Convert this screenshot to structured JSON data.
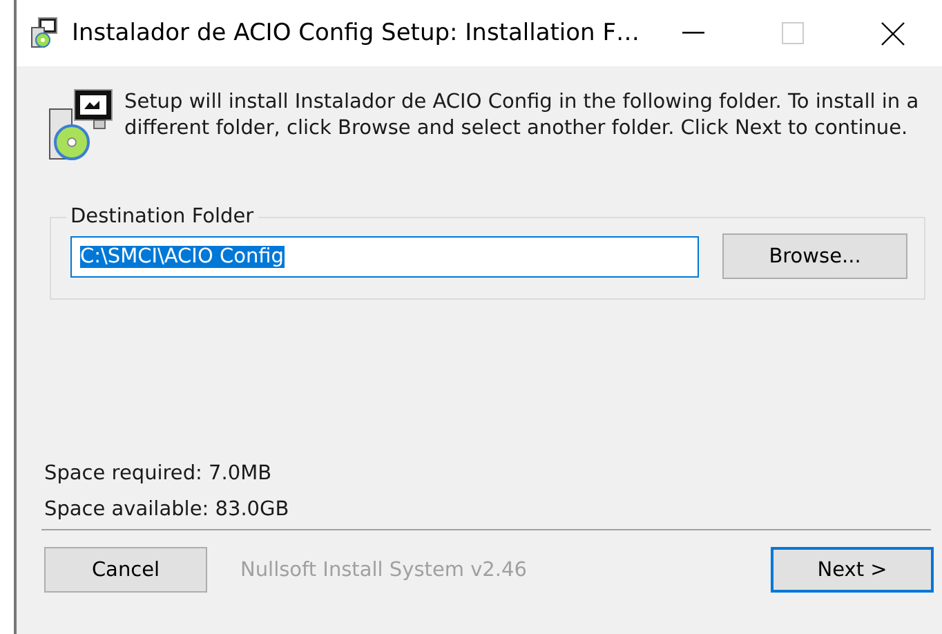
{
  "window": {
    "title": "Instalador de ACIO Config Setup: Installation F…",
    "maximize_disabled": true
  },
  "intro": "Setup will install Instalador de ACIO Config in the following folder. To install in a different folder, click Browse and select another folder. Click Next to continue.",
  "destination": {
    "label": "Destination Folder",
    "value": "C:\\SMCI\\ACIO Config",
    "text_selected": true,
    "browse": "Browse..."
  },
  "space_required": "Space required: 7.0MB",
  "space_available": "Space available: 83.0GB",
  "branding": "Nullsoft Install System v2.46",
  "buttons": [
    {
      "label": "Cancel",
      "default": false
    },
    {
      "label": "Next >",
      "default": true
    }
  ]
}
